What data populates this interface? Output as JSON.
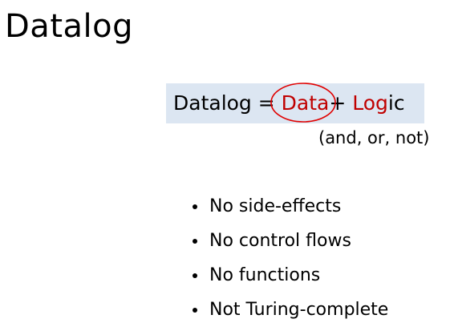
{
  "slide": {
    "title": "Datalog"
  },
  "equation": {
    "prefix": "Datalog = ",
    "data_word": "Data",
    "plus": "+ ",
    "logic_red": "Log",
    "logic_rest": "ic",
    "note": "(and, or, not)"
  },
  "bullets": [
    "No side-effects",
    "No control flows",
    "No functions",
    "Not Turing-complete"
  ],
  "colors": {
    "highlight_box": "#dce6f2",
    "accent_red": "#c00000"
  }
}
